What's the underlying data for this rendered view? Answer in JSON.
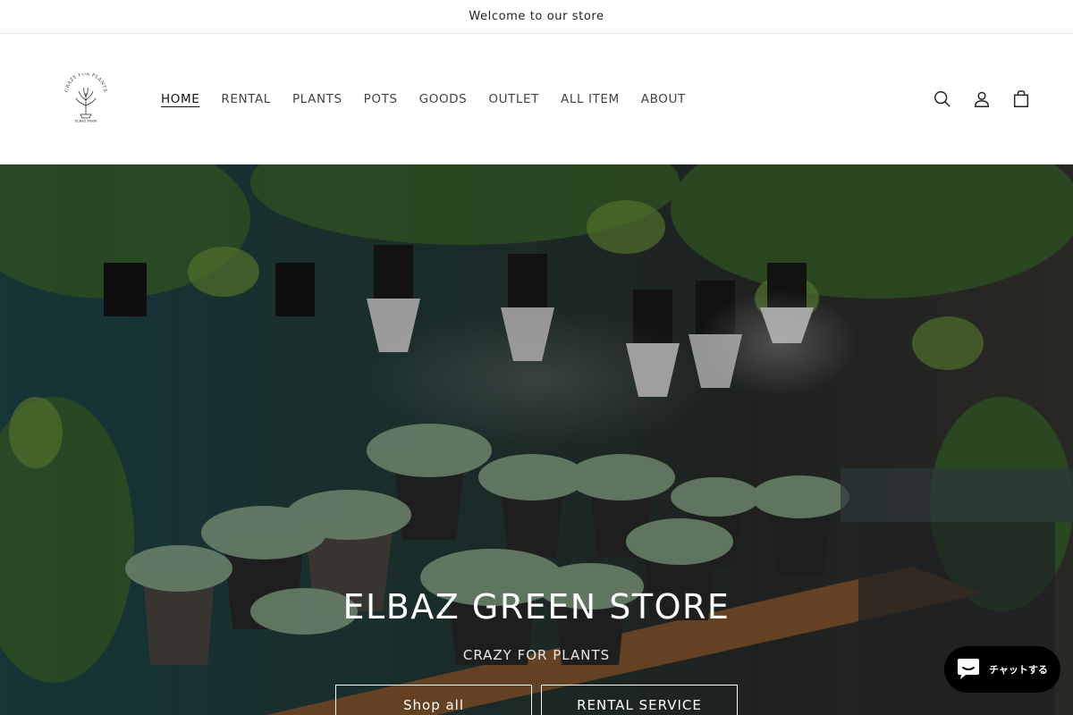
{
  "announcement": {
    "text": "Welcome to our store"
  },
  "header": {
    "logo": {
      "text": "CRAZY FOR PLANTS",
      "subtext": "ELBAZ FARM",
      "icon": "plant-logo-icon"
    },
    "nav": [
      {
        "label": "HOME",
        "active": true
      },
      {
        "label": "RENTAL",
        "active": false
      },
      {
        "label": "PLANTS",
        "active": false
      },
      {
        "label": "POTS",
        "active": false
      },
      {
        "label": "GOODS",
        "active": false
      },
      {
        "label": "OUTLET",
        "active": false
      },
      {
        "label": "ALL ITEM",
        "active": false
      },
      {
        "label": "ABOUT",
        "active": false
      }
    ],
    "icons": [
      "search-icon",
      "account-icon",
      "cart-icon"
    ]
  },
  "hero": {
    "title": "ELBAZ GREEN STORE",
    "subtitle": "CRAZY FOR PLANTS",
    "buttons": [
      {
        "label": "Shop all"
      },
      {
        "label": "RENTAL SERVICE"
      }
    ]
  },
  "chat": {
    "label": "チャットする",
    "icon": "chat-bubble-icon",
    "color": "#000000"
  }
}
